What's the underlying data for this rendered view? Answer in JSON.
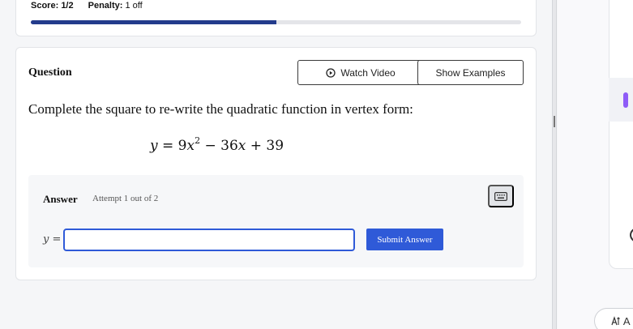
{
  "score": {
    "score_label": "Score:",
    "score_value": "1/2",
    "penalty_label": "Penalty:",
    "penalty_value": "1 off",
    "progress_fraction": 0.5
  },
  "question": {
    "title": "Question",
    "watch_video_label": "Watch Video",
    "show_examples_label": "Show Examples",
    "prompt": "Complete the square to re-write the quadratic function in vertex form:",
    "equation": {
      "lhs": "y",
      "eq": " = 9",
      "x": "x",
      "exp": "2",
      "mid": " − 36",
      "x2": "x",
      "tail": " + 39"
    }
  },
  "answer": {
    "title": "Answer",
    "attempt": "Attempt 1 out of 2",
    "y_var": "y",
    "y_eq": " =",
    "input_value": "",
    "submit_label": "Submit Answer"
  },
  "right_panel": {
    "pill_label": "A"
  },
  "colors": {
    "primary": "#2f5ad8",
    "progress": "#233b8c",
    "accent": "#8e5cf7"
  },
  "icons": {
    "watch_video": "play-circle-icon",
    "keyboard": "keyboard-icon",
    "pill": "text-size-icon"
  }
}
